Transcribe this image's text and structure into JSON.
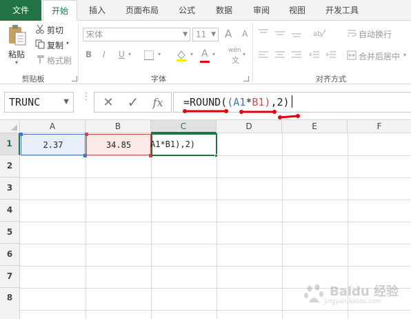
{
  "ribbon_tabs": [
    "文件",
    "开始",
    "插入",
    "页面布局",
    "公式",
    "数据",
    "审阅",
    "视图",
    "开发工具"
  ],
  "clipboard": {
    "paste_label": "粘贴",
    "cut_label": "剪切",
    "copy_label": "复制",
    "format_painter_label": "格式刷",
    "group_label": "剪贴板"
  },
  "font": {
    "font_name": "宋体",
    "font_size": "11",
    "bold": "B",
    "italic": "I",
    "underline": "U",
    "grow": "A",
    "shrink": "A",
    "font_color": "A",
    "phonetic": "wén",
    "group_label": "字体"
  },
  "alignment": {
    "wrap_text_label": "自动换行",
    "merge_center_label": "合并后居中",
    "group_label": "对齐方式"
  },
  "formula_bar": {
    "name_box": "TRUNC",
    "cancel_icon": "✕",
    "enter_icon": "✓",
    "fx_label": "fx",
    "formula_parts": [
      "=ROUND(",
      "(",
      "A1",
      "*",
      "B1",
      ")",
      ",2)"
    ]
  },
  "sheet": {
    "columns": [
      "A",
      "B",
      "C",
      "D",
      "E",
      "F"
    ],
    "rows": [
      "1",
      "2",
      "3",
      "4",
      "5",
      "6",
      "7",
      "8"
    ],
    "cells": {
      "A1": "2.37",
      "B1": "34.85",
      "C1": "A1*B1),2)"
    }
  },
  "colors": {
    "accent_green": "#217346",
    "ref_blue": "#4472c4",
    "ref_red": "#c0504d",
    "annotation_red": "#e60012"
  },
  "watermark": {
    "title": "Baidu 经验",
    "subtitle": "jingyan.baidu.com"
  }
}
